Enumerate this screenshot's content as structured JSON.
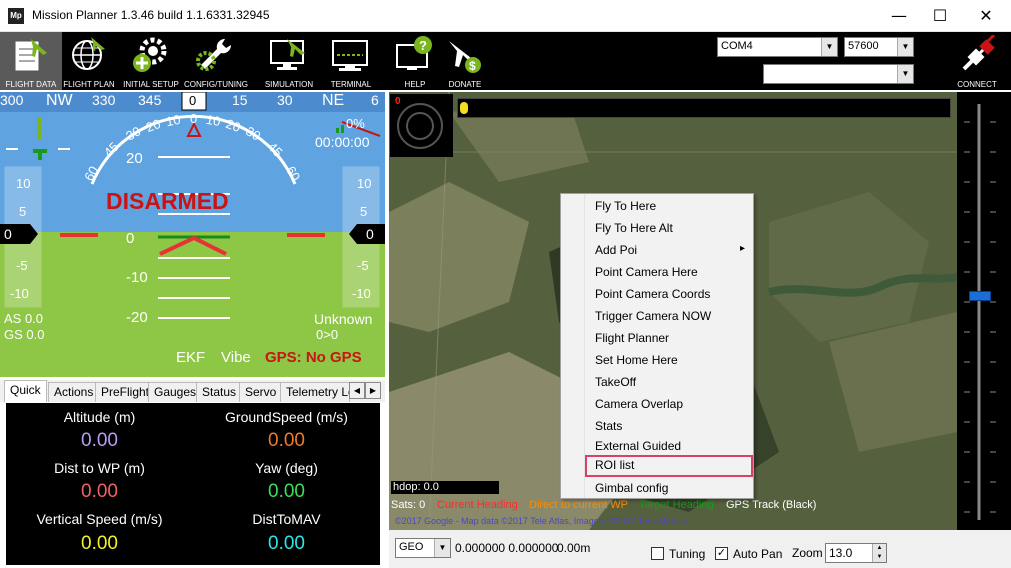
{
  "window": {
    "logo": "Mp",
    "title": "Mission Planner 1.3.46 build 1.1.6331.32945",
    "minimize": "—",
    "maximize": "☐",
    "close": "✕"
  },
  "toolbar": {
    "buttons": [
      {
        "label": "FLIGHT DATA",
        "icon": "flight-data-icon"
      },
      {
        "label": "FLIGHT PLAN",
        "icon": "flight-plan-icon"
      },
      {
        "label": "INITIAL SETUP",
        "icon": "initial-setup-icon"
      },
      {
        "label": "CONFIG/TUNING",
        "icon": "config-tuning-icon"
      },
      {
        "label": "SIMULATION",
        "icon": "simulation-icon"
      },
      {
        "label": "TERMINAL",
        "icon": "terminal-icon"
      },
      {
        "label": "HELP",
        "icon": "help-icon"
      },
      {
        "label": "DONATE",
        "icon": "donate-icon"
      }
    ],
    "port": "COM4",
    "baud": "57600",
    "extra": "",
    "connect_label": "CONNECT"
  },
  "hud": {
    "heading_ticks": [
      "300",
      "NW",
      "330",
      "345",
      "N",
      "15",
      "30",
      "NE",
      "6"
    ],
    "heading_value": "0",
    "roll_ticks": [
      "60",
      "45",
      "30",
      "20",
      "10",
      "0",
      "10",
      "20",
      "30",
      "45",
      "60"
    ],
    "pitch_ticks": [
      "20",
      "0",
      "-10",
      "-20"
    ],
    "speed_ticks": [
      "10",
      "5",
      "0",
      "-5",
      "-10"
    ],
    "alt_ticks": [
      "10",
      "5",
      "0",
      "-5",
      "-10"
    ],
    "speed_value": "0",
    "alt_value": "0",
    "armed_status": "DISARMED",
    "battery": "0%",
    "timer": "00:00:00",
    "as": "AS 0.0",
    "gs": "GS 0.0",
    "mode": "Unknown",
    "wp": "0>0",
    "ekf": "EKF",
    "vibe": "Vibe",
    "gps": "GPS: No GPS",
    "colors": {
      "sky": "#5fa3e0",
      "ground": "#8ec646",
      "alert": "#c81414",
      "horizon": "#e63232"
    }
  },
  "tabs": [
    "Quick",
    "Actions",
    "PreFlight",
    "Gauges",
    "Status",
    "Servo",
    "Telemetry Lo"
  ],
  "quick": [
    {
      "label": "Altitude (m)",
      "value": "0.00",
      "color": "#b99cf2"
    },
    {
      "label": "GroundSpeed (m/s)",
      "value": "0.00",
      "color": "#f07a2a"
    },
    {
      "label": "Dist to WP (m)",
      "value": "0.00",
      "color": "#f06262"
    },
    {
      "label": "Yaw (deg)",
      "value": "0.00",
      "color": "#38e05a"
    },
    {
      "label": "Vertical Speed (m/s)",
      "value": "0.00",
      "color": "#f2f22a"
    },
    {
      "label": "DistToMAV",
      "value": "0.00",
      "color": "#2ae8e8"
    }
  ],
  "map": {
    "gimbal_value": "0",
    "hdop": "hdop: 0.0",
    "sats": "Sats: 0",
    "legend": [
      {
        "text": "Current Heading",
        "color": "#ff2a2a"
      },
      {
        "text": "Direct to current WP",
        "color": "#ff8a00"
      },
      {
        "text": "Target Heading",
        "color": "#1a9a1a"
      },
      {
        "text": "GPS Track (Black)",
        "color": "#ffffff"
      }
    ],
    "copyright": "©2017 Google - Map data ©2017 Tele Atlas, Imagery ©2017 TerraMetrics"
  },
  "context_menu": [
    {
      "label": "Fly To Here"
    },
    {
      "label": "Fly To Here Alt"
    },
    {
      "label": "Add Poi",
      "submenu": "▸"
    },
    {
      "label": "Point Camera Here"
    },
    {
      "label": "Point Camera Coords"
    },
    {
      "label": "Trigger Camera NOW"
    },
    {
      "label": "Flight Planner"
    },
    {
      "label": "Set Home Here"
    },
    {
      "label": "TakeOff"
    },
    {
      "label": "Camera Overlap"
    },
    {
      "label": "Stats"
    },
    {
      "label": "External Guided"
    },
    {
      "label": "ROI list"
    },
    {
      "label": "Gimbal config"
    }
  ],
  "bottom": {
    "coord_system": "GEO",
    "coords": "0.000000 0.000000",
    "alt": "0.00m",
    "tuning_label": "Tuning",
    "tuning_checked": false,
    "autopan_label": "Auto Pan",
    "autopan_checked": true,
    "check_mark": "✓",
    "zoom_label": "Zoom",
    "zoom_value": "13.0"
  }
}
